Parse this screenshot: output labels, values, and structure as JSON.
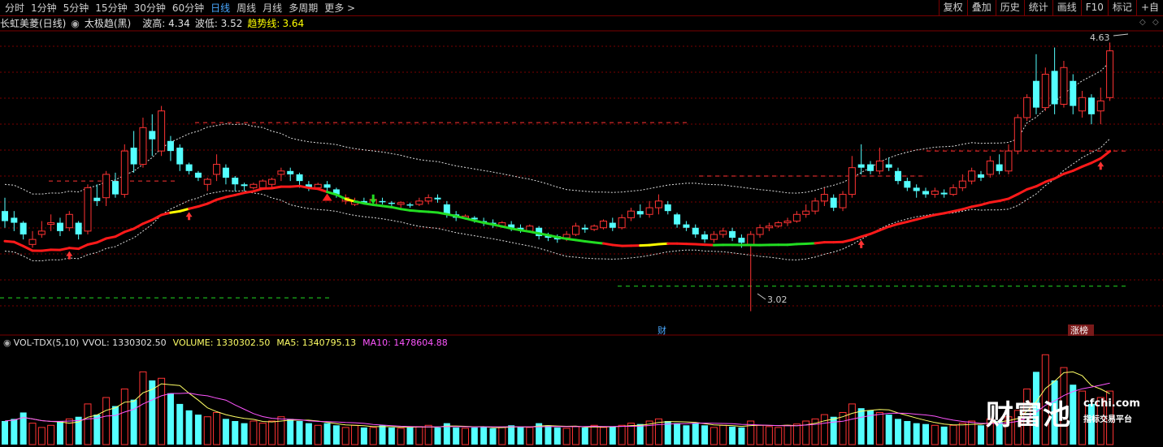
{
  "toolbar": {
    "period_tabs": [
      "分时",
      "1分钟",
      "5分钟",
      "15分钟",
      "30分钟",
      "60分钟",
      "日线",
      "周线",
      "月线",
      "多周期",
      "更多"
    ],
    "active_tab": "日线",
    "right_buttons": [
      "复权",
      "叠加",
      "历史",
      "统计",
      "画线",
      "F10",
      "标记",
      "+自"
    ]
  },
  "info": {
    "stock_name": "长虹美菱(日线)",
    "indicator": "太极趋(黑)",
    "wave_high_label": "波高: 4.34",
    "wave_low_label": "波低: 3.52",
    "trend_label": "趋势线:",
    "trend_value": "3.64"
  },
  "annotations": {
    "high_price": "4.63",
    "low_price": "3.02",
    "finance_tag": "财",
    "limit_up_tag": "涨榜"
  },
  "volume_info": {
    "name": "VOL-TDX(5,10)",
    "vvol": "VVOL: 1330302.50",
    "volume": "VOLUME: 1330302.50",
    "ma5": "MA5: 1340795.13",
    "ma10": "MA10: 1478604.88"
  },
  "watermark": {
    "brand": "财富池",
    "url": "cfchi.com",
    "slogan": "指标交易平台"
  },
  "colors": {
    "up": "#ff3333",
    "down": "#54ffff",
    "trend_red": "#ff1a1a",
    "trend_green": "#22dd22",
    "trend_yellow": "#ffff00",
    "ma5": "#ffff66",
    "ma10": "#ff55ff",
    "grid": "#7a0000"
  },
  "chart_data": {
    "type": "candlestick",
    "price_range": [
      2.95,
      4.7
    ],
    "candles": [
      [
        3.62,
        3.7,
        3.56,
        3.52,
        0
      ],
      [
        3.58,
        3.62,
        3.55,
        3.5,
        0
      ],
      [
        3.55,
        3.56,
        3.48,
        3.45,
        0
      ],
      [
        3.45,
        3.5,
        3.42,
        3.4,
        1
      ],
      [
        3.48,
        3.56,
        3.5,
        3.46,
        1
      ],
      [
        3.55,
        3.6,
        3.54,
        3.5,
        1
      ],
      [
        3.55,
        3.58,
        3.5,
        3.47,
        0
      ],
      [
        3.52,
        3.62,
        3.6,
        3.5,
        1
      ],
      [
        3.55,
        3.56,
        3.48,
        3.45,
        0
      ],
      [
        3.5,
        3.78,
        3.76,
        3.48,
        1
      ],
      [
        3.7,
        3.78,
        3.68,
        3.65,
        0
      ],
      [
        3.7,
        3.86,
        3.84,
        3.65,
        1
      ],
      [
        3.8,
        3.85,
        3.72,
        3.7,
        0
      ],
      [
        3.72,
        4.02,
        3.98,
        3.7,
        1
      ],
      [
        4.0,
        4.1,
        3.9,
        3.85,
        0
      ],
      [
        3.9,
        4.18,
        4.12,
        3.88,
        1
      ],
      [
        4.1,
        4.2,
        4.05,
        3.95,
        0
      ],
      [
        3.98,
        4.25,
        4.22,
        3.95,
        1
      ],
      [
        4.04,
        4.07,
        3.98,
        3.92,
        0
      ],
      [
        4.0,
        4.02,
        3.9,
        3.86,
        0
      ],
      [
        3.9,
        3.91,
        3.86,
        3.84,
        0
      ],
      [
        3.85,
        3.86,
        3.82,
        3.8,
        0
      ],
      [
        3.78,
        3.82,
        3.81,
        3.74,
        1
      ],
      [
        3.84,
        3.96,
        3.9,
        3.8,
        1
      ],
      [
        3.88,
        3.9,
        3.82,
        3.78,
        0
      ],
      [
        3.82,
        3.83,
        3.78,
        3.74,
        0
      ],
      [
        3.78,
        3.79,
        3.77,
        3.74,
        0
      ],
      [
        3.76,
        3.79,
        3.78,
        3.75,
        1
      ],
      [
        3.76,
        3.81,
        3.8,
        3.75,
        1
      ],
      [
        3.78,
        3.82,
        3.81,
        3.76,
        1
      ],
      [
        3.84,
        3.88,
        3.86,
        3.8,
        1
      ],
      [
        3.86,
        3.88,
        3.84,
        3.8,
        0
      ],
      [
        3.84,
        3.85,
        3.8,
        3.76,
        0
      ],
      [
        3.78,
        3.8,
        3.76,
        3.74,
        0
      ],
      [
        3.76,
        3.79,
        3.78,
        3.75,
        1
      ],
      [
        3.78,
        3.8,
        3.76,
        3.74,
        0
      ],
      [
        3.75,
        3.76,
        3.72,
        3.7,
        0
      ],
      [
        3.68,
        3.72,
        3.7,
        3.66,
        1
      ],
      [
        3.66,
        3.7,
        3.68,
        3.65,
        1
      ],
      [
        3.68,
        3.7,
        3.67,
        3.66,
        0
      ],
      [
        3.66,
        3.7,
        3.69,
        3.65,
        1
      ],
      [
        3.68,
        3.7,
        3.68,
        3.66,
        0
      ],
      [
        3.67,
        3.68,
        3.67,
        3.65,
        0
      ],
      [
        3.66,
        3.68,
        3.67,
        3.64,
        1
      ],
      [
        3.66,
        3.67,
        3.66,
        3.64,
        0
      ],
      [
        3.66,
        3.7,
        3.68,
        3.65,
        1
      ],
      [
        3.68,
        3.72,
        3.7,
        3.66,
        1
      ],
      [
        3.7,
        3.72,
        3.69,
        3.67,
        0
      ],
      [
        3.66,
        3.68,
        3.6,
        3.58,
        0
      ],
      [
        3.6,
        3.62,
        3.58,
        3.56,
        0
      ],
      [
        3.58,
        3.6,
        3.59,
        3.57,
        1
      ],
      [
        3.58,
        3.59,
        3.57,
        3.55,
        0
      ],
      [
        3.56,
        3.58,
        3.55,
        3.53,
        0
      ],
      [
        3.55,
        3.57,
        3.54,
        3.52,
        0
      ],
      [
        3.53,
        3.56,
        3.55,
        3.52,
        1
      ],
      [
        3.54,
        3.56,
        3.52,
        3.5,
        0
      ],
      [
        3.52,
        3.54,
        3.51,
        3.49,
        0
      ],
      [
        3.5,
        3.54,
        3.53,
        3.49,
        1
      ],
      [
        3.52,
        3.53,
        3.47,
        3.45,
        0
      ],
      [
        3.48,
        3.49,
        3.46,
        3.44,
        0
      ],
      [
        3.47,
        3.48,
        3.45,
        3.43,
        0
      ],
      [
        3.46,
        3.5,
        3.48,
        3.44,
        1
      ],
      [
        3.48,
        3.55,
        3.53,
        3.47,
        1
      ],
      [
        3.52,
        3.54,
        3.51,
        3.49,
        0
      ],
      [
        3.51,
        3.54,
        3.53,
        3.5,
        1
      ],
      [
        3.52,
        3.57,
        3.56,
        3.51,
        1
      ],
      [
        3.55,
        3.58,
        3.52,
        3.5,
        0
      ],
      [
        3.52,
        3.6,
        3.58,
        3.51,
        1
      ],
      [
        3.58,
        3.64,
        3.62,
        3.56,
        1
      ],
      [
        3.62,
        3.66,
        3.6,
        3.58,
        0
      ],
      [
        3.6,
        3.68,
        3.64,
        3.58,
        1
      ],
      [
        3.64,
        3.72,
        3.68,
        3.6,
        1
      ],
      [
        3.66,
        3.68,
        3.62,
        3.6,
        0
      ],
      [
        3.6,
        3.61,
        3.54,
        3.52,
        0
      ],
      [
        3.54,
        3.56,
        3.52,
        3.5,
        0
      ],
      [
        3.52,
        3.54,
        3.48,
        3.46,
        0
      ],
      [
        3.48,
        3.5,
        3.45,
        3.43,
        0
      ],
      [
        3.45,
        3.5,
        3.48,
        3.43,
        1
      ],
      [
        3.48,
        3.52,
        3.5,
        3.46,
        1
      ],
      [
        3.5,
        3.52,
        3.46,
        3.44,
        0
      ],
      [
        3.46,
        3.48,
        3.43,
        3.4,
        0
      ],
      [
        3.42,
        3.5,
        3.48,
        3.02,
        1
      ],
      [
        3.48,
        3.54,
        3.52,
        3.46,
        1
      ],
      [
        3.52,
        3.55,
        3.53,
        3.5,
        1
      ],
      [
        3.53,
        3.56,
        3.55,
        3.52,
        1
      ],
      [
        3.55,
        3.58,
        3.56,
        3.53,
        1
      ],
      [
        3.56,
        3.62,
        3.6,
        3.55,
        1
      ],
      [
        3.6,
        3.66,
        3.62,
        3.58,
        1
      ],
      [
        3.62,
        3.7,
        3.68,
        3.6,
        1
      ],
      [
        3.68,
        3.76,
        3.72,
        3.65,
        1
      ],
      [
        3.7,
        3.72,
        3.64,
        3.62,
        0
      ],
      [
        3.64,
        3.74,
        3.72,
        3.62,
        1
      ],
      [
        3.72,
        3.95,
        3.88,
        3.7,
        1
      ],
      [
        3.88,
        4.02,
        3.9,
        3.84,
        0
      ],
      [
        3.9,
        3.92,
        3.86,
        3.84,
        0
      ],
      [
        3.86,
        4.0,
        3.92,
        3.84,
        1
      ],
      [
        3.9,
        3.94,
        3.88,
        3.86,
        0
      ],
      [
        3.86,
        3.88,
        3.8,
        3.78,
        0
      ],
      [
        3.8,
        3.82,
        3.76,
        3.74,
        0
      ],
      [
        3.76,
        3.78,
        3.74,
        3.7,
        0
      ],
      [
        3.74,
        3.76,
        3.72,
        3.7,
        0
      ],
      [
        3.72,
        3.76,
        3.74,
        3.7,
        1
      ],
      [
        3.73,
        3.75,
        3.72,
        3.7,
        0
      ],
      [
        3.72,
        3.78,
        3.76,
        3.71,
        1
      ],
      [
        3.76,
        3.84,
        3.8,
        3.74,
        1
      ],
      [
        3.8,
        3.88,
        3.86,
        3.78,
        1
      ],
      [
        3.84,
        3.86,
        3.82,
        3.8,
        0
      ],
      [
        3.84,
        3.95,
        3.92,
        3.82,
        1
      ],
      [
        3.9,
        3.96,
        3.86,
        3.84,
        0
      ],
      [
        3.86,
        4.02,
        3.98,
        3.84,
        1
      ],
      [
        3.98,
        4.2,
        4.18,
        3.96,
        1
      ],
      [
        4.18,
        4.32,
        4.3,
        4.16,
        1
      ],
      [
        4.4,
        4.56,
        4.24,
        4.2,
        0
      ],
      [
        4.24,
        4.48,
        4.44,
        4.22,
        1
      ],
      [
        4.46,
        4.6,
        4.26,
        4.2,
        0
      ],
      [
        4.26,
        4.52,
        4.48,
        4.24,
        1
      ],
      [
        4.4,
        4.44,
        4.25,
        4.2,
        0
      ],
      [
        4.22,
        4.34,
        4.3,
        4.18,
        1
      ],
      [
        4.3,
        4.32,
        4.2,
        4.14,
        0
      ],
      [
        4.22,
        4.36,
        4.28,
        4.14,
        1
      ],
      [
        4.3,
        4.63,
        4.58,
        4.28,
        1
      ]
    ],
    "volumes": [
      0.55,
      0.6,
      0.75,
      0.5,
      0.4,
      0.45,
      0.55,
      0.6,
      0.65,
      0.95,
      0.7,
      1.1,
      0.9,
      1.3,
      1.05,
      1.7,
      1.5,
      1.55,
      1.2,
      0.95,
      0.8,
      0.7,
      0.65,
      0.75,
      0.6,
      0.55,
      0.5,
      0.55,
      0.5,
      0.55,
      0.65,
      0.6,
      0.55,
      0.5,
      0.45,
      0.5,
      0.45,
      0.4,
      0.45,
      0.4,
      0.4,
      0.45,
      0.4,
      0.38,
      0.4,
      0.42,
      0.45,
      0.4,
      0.5,
      0.4,
      0.38,
      0.4,
      0.42,
      0.38,
      0.4,
      0.45,
      0.42,
      0.4,
      0.5,
      0.45,
      0.4,
      0.38,
      0.42,
      0.4,
      0.45,
      0.4,
      0.42,
      0.45,
      0.5,
      0.48,
      0.55,
      0.6,
      0.55,
      0.5,
      0.45,
      0.5,
      0.45,
      0.4,
      0.45,
      0.42,
      0.4,
      0.55,
      0.45,
      0.42,
      0.4,
      0.45,
      0.48,
      0.55,
      0.6,
      0.7,
      0.65,
      0.75,
      0.95,
      0.85,
      0.8,
      0.75,
      0.7,
      0.6,
      0.55,
      0.5,
      0.48,
      0.45,
      0.42,
      0.45,
      0.5,
      0.55,
      0.45,
      0.6,
      0.55,
      0.65,
      0.8,
      1.3,
      1.7,
      2.1,
      1.5,
      1.8,
      1.4,
      1.25,
      0.95,
      1.1,
      1.25
    ],
    "markers": {
      "buy_arrows": [
        7,
        20,
        93,
        119
      ],
      "sell_arrow_green": 40,
      "red_triangle": 35
    }
  }
}
